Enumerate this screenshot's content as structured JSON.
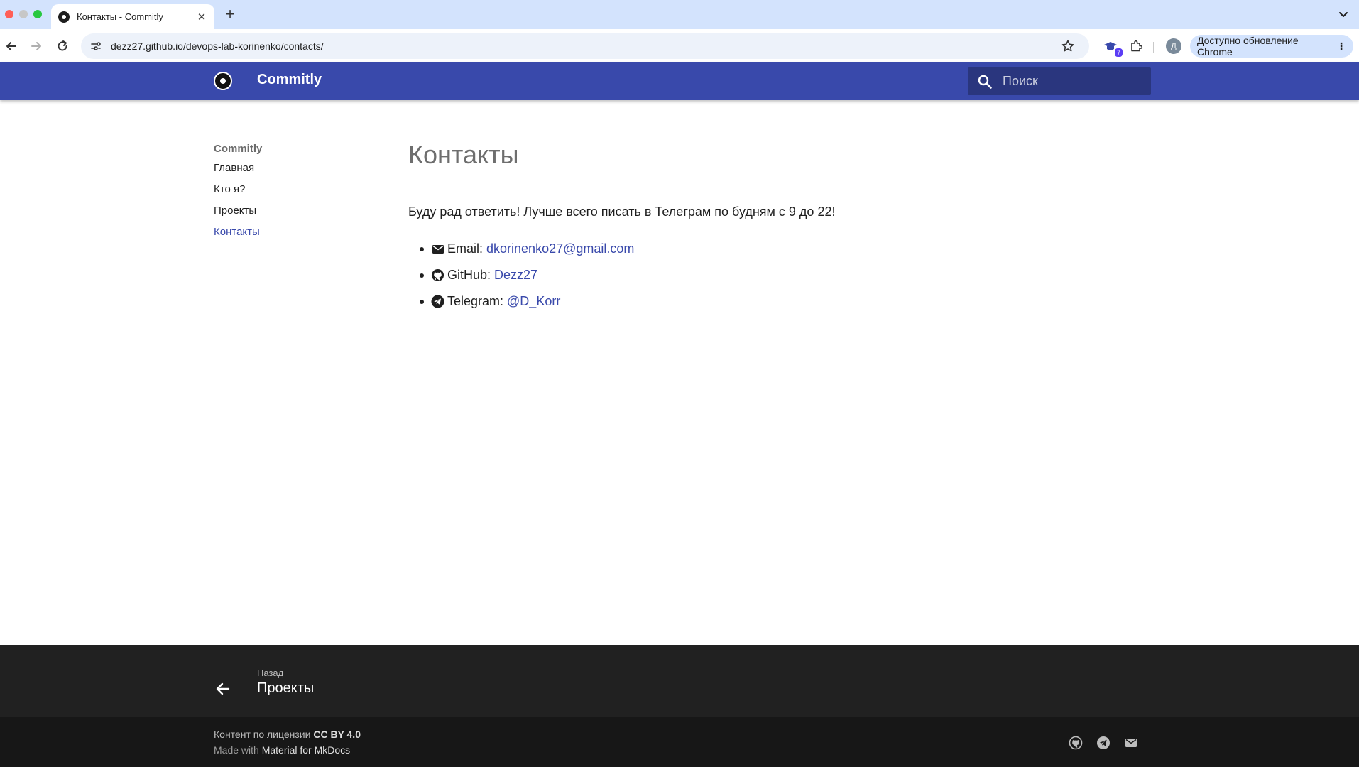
{
  "browser": {
    "tab_title": "Контакты - Commitly",
    "tab_close": "✕",
    "new_tab": "+",
    "url": "dezz27.github.io/devops-lab-korinenko/contacts/",
    "extension_badge": "7",
    "avatar_initial": "Д",
    "update_label": "Доступно обновление Chrome",
    "update_menu": "⋮"
  },
  "header": {
    "site_title": "Commitly",
    "search_placeholder": "Поиск"
  },
  "sidebar": {
    "title": "Commitly",
    "items": [
      {
        "label": "Главная",
        "active": false
      },
      {
        "label": "Кто я?",
        "active": false
      },
      {
        "label": "Проекты",
        "active": false
      },
      {
        "label": "Контакты",
        "active": true
      }
    ]
  },
  "main": {
    "page_title": "Контакты",
    "lead": "Буду рад ответить! Лучше всего писать в Телеграм по будням с 9 до 22!",
    "contacts": [
      {
        "label": "Email:",
        "value": "dkorinenko27@gmail.com",
        "icon": "email-icon"
      },
      {
        "label": "GitHub:",
        "value": "Dezz27",
        "icon": "github-icon"
      },
      {
        "label": "Telegram:",
        "value": "@D_Korr",
        "icon": "telegram-icon"
      }
    ]
  },
  "footer": {
    "back_label": "Назад",
    "back_page": "Проекты",
    "license_prefix": "Контент по лицензии",
    "license_name": "CC BY 4.0",
    "made_with_prefix": "Made with",
    "made_with_name": "Material for MkDocs"
  },
  "colors": {
    "primary": "#3949ab",
    "footer_dark": "#212121",
    "footer_darker": "#171717"
  }
}
